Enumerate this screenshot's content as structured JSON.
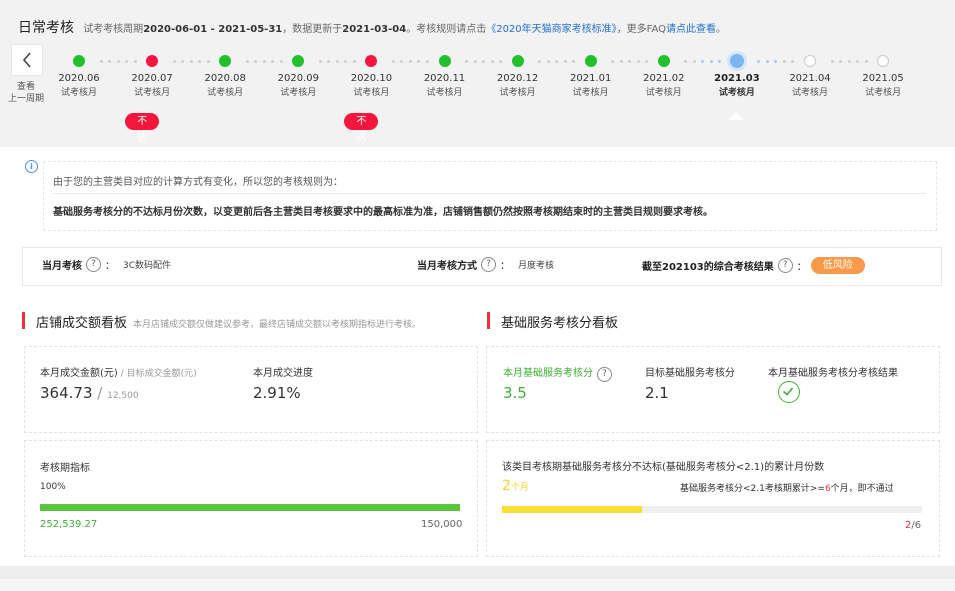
{
  "header": {
    "title": "日常考核",
    "period_prefix": "试考考核周期",
    "period": "2020-06-01 - 2021-05-31",
    "updated_prefix": "，数据更新于",
    "updated": "2021-03-04",
    "rule_prefix": "。考核规则请点击",
    "rule_link": "《2020年天猫商家考核标准》",
    "faq_prefix": "，更多FAQ",
    "faq_link": "请点此查看",
    "faq_suffix": "。"
  },
  "back": {
    "label_line1": "查看",
    "label_line2": "上一周期"
  },
  "months": [
    {
      "label": "2020.06",
      "sub": "试考核月",
      "status": "pass"
    },
    {
      "label": "2020.07",
      "sub": "试考核月",
      "status": "fail",
      "badge": "不达标"
    },
    {
      "label": "2020.08",
      "sub": "试考核月",
      "status": "pass"
    },
    {
      "label": "2020.09",
      "sub": "试考核月",
      "status": "pass"
    },
    {
      "label": "2020.10",
      "sub": "试考核月",
      "status": "fail",
      "badge": "不达标"
    },
    {
      "label": "2020.11",
      "sub": "试考核月",
      "status": "pass"
    },
    {
      "label": "2020.12",
      "sub": "试考核月",
      "status": "pass"
    },
    {
      "label": "2021.01",
      "sub": "试考核月",
      "status": "pass"
    },
    {
      "label": "2021.02",
      "sub": "试考核月",
      "status": "pass"
    },
    {
      "label": "2021.03",
      "sub": "试考核月",
      "status": "current"
    },
    {
      "label": "2021.04",
      "sub": "试考核月",
      "status": "future"
    },
    {
      "label": "2021.05",
      "sub": "试考核月",
      "status": "future"
    }
  ],
  "notice": {
    "line1": "由于您的主营类目对应的计算方式有变化，所以您的考核规则为：",
    "line2": "基础服务考核分的不达标月份次数，以变更前后各主营类目考核要求中的最高标准为准，店铺销售额仍然按照考核期结束时的主营类目规则要求考核。"
  },
  "info_bar": {
    "month_label": "当月考核",
    "month_value": "3C数码配件",
    "method_label": "当月考核方式",
    "method_value": "月度考核",
    "result_label": "截至202103的综合考核结果",
    "result_value": "低风险",
    "colon": "："
  },
  "sales_board": {
    "title": "店铺成交额看板",
    "desc": "本月店铺成交额仅做建议参考，最终店铺成交额以考核期指标进行考核。",
    "amount_label": "本月成交金额(元)",
    "target_label": " / 目标成交金额(元)",
    "amount": "364.73",
    "target": "12,500",
    "progress_label": "本月成交进度",
    "progress": "2.91%",
    "period_label": "考核期指标",
    "period_percent": "100%",
    "period_fill": 1.0,
    "period_value": "252,539.27",
    "period_target": "150,000"
  },
  "service_board": {
    "title": "基础服务考核分看板",
    "score_label": "本月基础服务考核分",
    "score": "3.5",
    "target_label": "目标基础服务考核分",
    "target": "2.1",
    "result_label": "本月基础服务考核分考核结果",
    "fail_label": "该类目考核期基础服务考核分不达标(基础服务考核分<2.1)的累计月份数",
    "fail_count": "2",
    "fail_unit": "个月",
    "rule_prefix": "基础服务考核分<2.1考核期累计>=",
    "rule_num": "6",
    "rule_suffix": "个月，即不通过",
    "fraction_num": "2",
    "fraction_den": "/6",
    "fail_fill": 0.3333
  },
  "colors": {
    "pass": "#22c02c",
    "fail": "#f5163e",
    "accent": "#3cb034",
    "risk": "#f99a4a",
    "link": "#1e6fd9"
  }
}
